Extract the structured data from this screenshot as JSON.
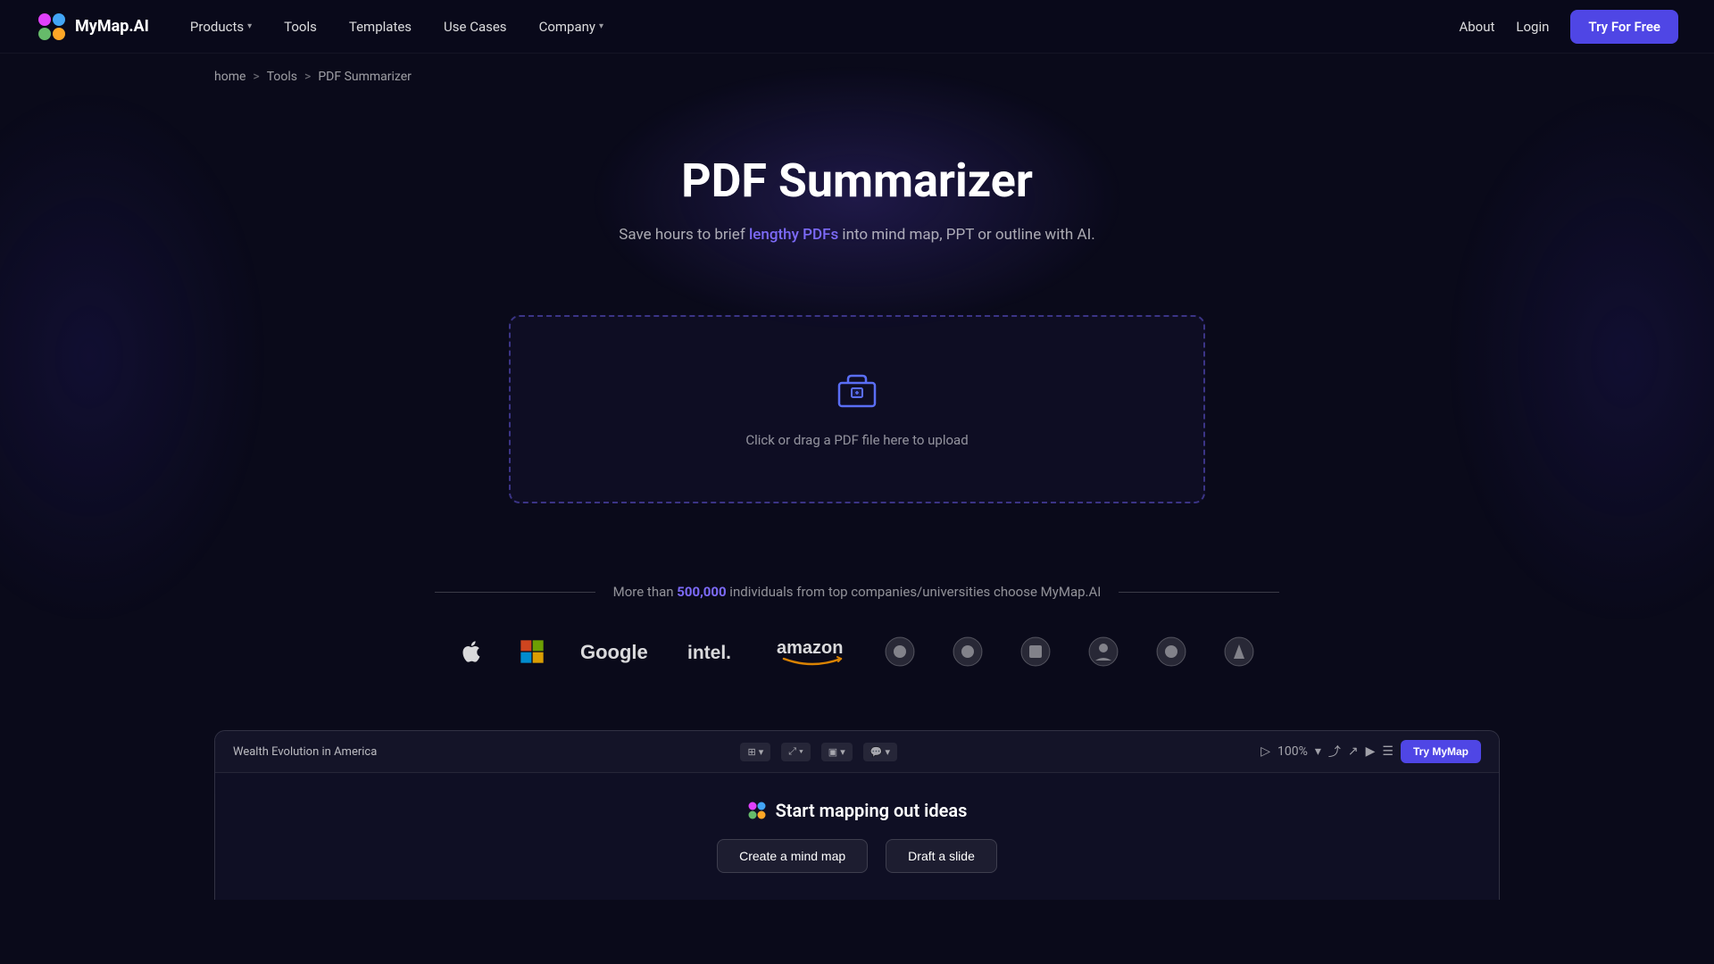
{
  "nav": {
    "logo_text": "MyMap.AI",
    "items": [
      {
        "label": "Products",
        "has_dropdown": true
      },
      {
        "label": "Tools",
        "has_dropdown": false
      },
      {
        "label": "Templates",
        "has_dropdown": false
      },
      {
        "label": "Use Cases",
        "has_dropdown": false
      },
      {
        "label": "Company",
        "has_dropdown": true
      }
    ],
    "right": {
      "about": "About",
      "login": "Login",
      "try_free": "Try For Free"
    }
  },
  "breadcrumb": {
    "home": "home",
    "tools": "Tools",
    "current": "PDF Summarizer"
  },
  "hero": {
    "title": "PDF Summarizer",
    "subtitle_before": "Save hours to brief ",
    "subtitle_highlight": "lengthy PDFs",
    "subtitle_after": " into mind map, PPT or outline with AI."
  },
  "upload": {
    "prompt": "Click or drag a PDF file here to upload"
  },
  "social_proof": {
    "before": "More than ",
    "count": "500,000",
    "after": " individuals from top companies/universities choose MyMap.AI"
  },
  "logos": [
    {
      "name": "Apple",
      "type": "svg"
    },
    {
      "name": "Microsoft",
      "type": "svg"
    },
    {
      "name": "Google",
      "type": "text"
    },
    {
      "name": "intel.",
      "type": "text"
    },
    {
      "name": "amazon",
      "type": "text"
    },
    {
      "name": "logo6",
      "type": "circle"
    },
    {
      "name": "logo7",
      "type": "circle"
    },
    {
      "name": "logo8",
      "type": "circle"
    },
    {
      "name": "logo9",
      "type": "circle"
    },
    {
      "name": "logo10",
      "type": "circle"
    },
    {
      "name": "logo11",
      "type": "circle"
    }
  ],
  "preview": {
    "title": "Wealth Evolution in America",
    "zoom": "100%",
    "try_mymap": "Try MyMap",
    "content_title": "Start mapping out ideas",
    "btn_create_mindmap": "Create a mind map",
    "btn_draft_slide": "Draft a slide"
  }
}
